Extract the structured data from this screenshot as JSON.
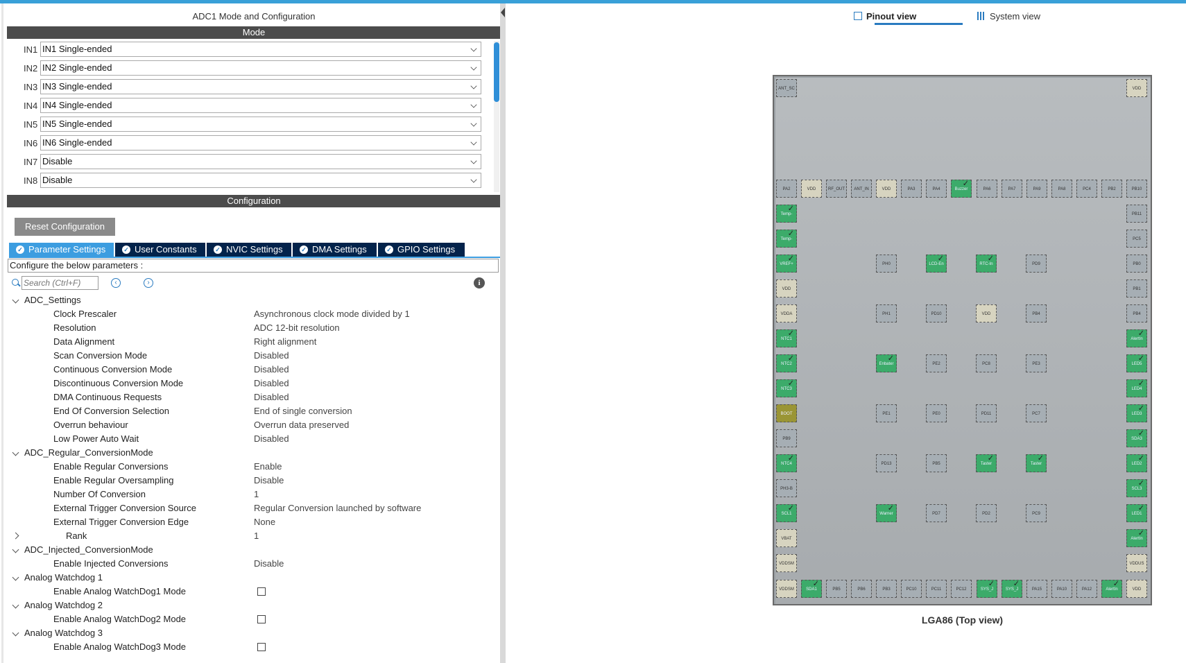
{
  "panel_title": "ADC1 Mode and Configuration",
  "mode_header": "Mode",
  "config_header": "Configuration",
  "mode_rows": [
    {
      "label": "IN1",
      "value": "IN1 Single-ended"
    },
    {
      "label": "IN2",
      "value": "IN2 Single-ended"
    },
    {
      "label": "IN3",
      "value": "IN3 Single-ended"
    },
    {
      "label": "IN4",
      "value": "IN4 Single-ended"
    },
    {
      "label": "IN5",
      "value": "IN5 Single-ended"
    },
    {
      "label": "IN6",
      "value": "IN6 Single-ended"
    },
    {
      "label": "IN7",
      "value": "Disable"
    },
    {
      "label": "IN8",
      "value": "Disable"
    }
  ],
  "reset_label": "Reset Configuration",
  "tabs": [
    {
      "label": "Parameter Settings",
      "active": true
    },
    {
      "label": "User Constants",
      "active": false
    },
    {
      "label": "NVIC Settings",
      "active": false
    },
    {
      "label": "DMA Settings",
      "active": false
    },
    {
      "label": "GPIO Settings",
      "active": false
    }
  ],
  "description": "Configure the below parameters :",
  "search": {
    "placeholder": "Search (Ctrl+F)"
  },
  "tree": [
    {
      "kind": "group",
      "name": "ADC_Settings",
      "expanded": true
    },
    {
      "kind": "param",
      "name": "Clock Prescaler",
      "value": "Asynchronous clock mode divided by 1"
    },
    {
      "kind": "param",
      "name": "Resolution",
      "value": "ADC 12-bit resolution"
    },
    {
      "kind": "param",
      "name": "Data Alignment",
      "value": "Right alignment"
    },
    {
      "kind": "param",
      "name": "Scan Conversion Mode",
      "value": "Disabled"
    },
    {
      "kind": "param",
      "name": "Continuous Conversion Mode",
      "value": "Disabled"
    },
    {
      "kind": "param",
      "name": "Discontinuous Conversion Mode",
      "value": "Disabled"
    },
    {
      "kind": "param",
      "name": "DMA Continuous Requests",
      "value": "Disabled"
    },
    {
      "kind": "param",
      "name": "End Of Conversion Selection",
      "value": "End of single conversion"
    },
    {
      "kind": "param",
      "name": "Overrun behaviour",
      "value": "Overrun data preserved"
    },
    {
      "kind": "param",
      "name": "Low Power Auto Wait",
      "value": "Disabled"
    },
    {
      "kind": "group",
      "name": "ADC_Regular_ConversionMode",
      "expanded": true
    },
    {
      "kind": "param",
      "name": "Enable Regular Conversions",
      "value": "Enable"
    },
    {
      "kind": "param",
      "name": "Enable Regular Oversampling",
      "value": "Disable"
    },
    {
      "kind": "param",
      "name": "Number Of Conversion",
      "value": "1"
    },
    {
      "kind": "param",
      "name": "External Trigger Conversion Source",
      "value": "Regular Conversion launched by software"
    },
    {
      "kind": "param",
      "name": "External Trigger Conversion Edge",
      "value": "None"
    },
    {
      "kind": "subgroup",
      "name": "Rank",
      "value": "1",
      "expanded": false
    },
    {
      "kind": "group",
      "name": "ADC_Injected_ConversionMode",
      "expanded": true
    },
    {
      "kind": "param",
      "name": "Enable Injected Conversions",
      "value": "Disable"
    },
    {
      "kind": "group",
      "name": "Analog Watchdog 1",
      "expanded": true
    },
    {
      "kind": "check",
      "name": "Enable Analog WatchDog1 Mode",
      "checked": false
    },
    {
      "kind": "group",
      "name": "Analog Watchdog 2",
      "expanded": true
    },
    {
      "kind": "check",
      "name": "Enable Analog WatchDog2 Mode",
      "checked": false
    },
    {
      "kind": "group",
      "name": "Analog Watchdog 3",
      "expanded": true
    },
    {
      "kind": "check",
      "name": "Enable Analog WatchDog3 Mode",
      "checked": false
    }
  ],
  "view_tabs": [
    {
      "label": "Pinout view",
      "active": true
    },
    {
      "label": "System view",
      "active": false
    }
  ],
  "chip_label": "LGA86 (Top view)",
  "pin_colors": {
    "unused": "#a6aeb4",
    "power": "#d7d4c0",
    "assigned": "#3cab6a",
    "reset": "#9a9535"
  },
  "pins": [
    {
      "t": "g",
      "l": "ANT_SC"
    },
    {
      "t": "p",
      "l": "VDD"
    },
    {
      "t": "g",
      "l": "PA2"
    },
    {
      "t": "p",
      "l": "VDD"
    },
    {
      "t": "g",
      "l": "RF_OUT"
    },
    {
      "t": "g",
      "l": "ANT_IN"
    },
    {
      "t": "p",
      "l": "VDD"
    },
    {
      "t": "g",
      "l": "PA3"
    },
    {
      "t": "g",
      "l": "PA4"
    },
    {
      "t": "gr",
      "l": "Buzzer"
    },
    {
      "t": "g",
      "l": "PA6"
    },
    {
      "t": "g",
      "l": "PA7"
    },
    {
      "t": "g",
      "l": "PA9"
    },
    {
      "t": "g",
      "l": "PA8"
    },
    {
      "t": "g",
      "l": "PC4"
    },
    {
      "t": "g",
      "l": "PB2"
    },
    {
      "t": "g",
      "l": "PB10"
    },
    {
      "t": "gr",
      "l": "Temp-"
    },
    {
      "t": "gr",
      "l": "Temp-"
    },
    {
      "t": "gr",
      "l": "VREF+"
    },
    {
      "t": "p",
      "l": "VDD"
    },
    {
      "t": "p",
      "l": "VDDA"
    },
    {
      "t": "gr",
      "l": "NTC1"
    },
    {
      "t": "gr",
      "l": "NTC2"
    },
    {
      "t": "gr",
      "l": "NTC3"
    },
    {
      "t": "ol",
      "l": "BOOT"
    },
    {
      "t": "g",
      "l": "PB9"
    },
    {
      "t": "gr",
      "l": "NTC4"
    },
    {
      "t": "g",
      "l": "PH3-B"
    },
    {
      "t": "gr",
      "l": "SCL1"
    },
    {
      "t": "p",
      "l": "VBAT"
    },
    {
      "t": "p",
      "l": "VDDSM"
    },
    {
      "t": "g",
      "l": "PB11"
    },
    {
      "t": "g",
      "l": "PC5"
    },
    {
      "t": "g",
      "l": "PB0"
    },
    {
      "t": "g",
      "l": "PB1"
    },
    {
      "t": "g",
      "l": "PB4"
    },
    {
      "t": "gr",
      "l": "AlertIn"
    },
    {
      "t": "gr",
      "l": "LED5"
    },
    {
      "t": "gr",
      "l": "LED4"
    },
    {
      "t": "gr",
      "l": "LED3"
    },
    {
      "t": "gr",
      "l": "SDA3"
    },
    {
      "t": "gr",
      "l": "LED2"
    },
    {
      "t": "gr",
      "l": "SCL3"
    },
    {
      "t": "gr",
      "l": "LED1"
    },
    {
      "t": "gr",
      "l": "AlertIn"
    },
    {
      "t": "p",
      "l": "VDDUS"
    },
    {
      "t": "p",
      "l": "VDDSM"
    },
    {
      "t": "gr",
      "l": "SDA1"
    },
    {
      "t": "g",
      "l": "PB5"
    },
    {
      "t": "g",
      "l": "PB6"
    },
    {
      "t": "g",
      "l": "PB3"
    },
    {
      "t": "g",
      "l": "PC10"
    },
    {
      "t": "g",
      "l": "PC11"
    },
    {
      "t": "g",
      "l": "PC12"
    },
    {
      "t": "gr",
      "l": "SYS_J"
    },
    {
      "t": "gr",
      "l": "SYS_J"
    },
    {
      "t": "g",
      "l": "PA15"
    },
    {
      "t": "g",
      "l": "PA10"
    },
    {
      "t": "g",
      "l": "PA12"
    },
    {
      "t": "gr",
      "l": "AlertIn"
    },
    {
      "t": "p",
      "l": "VDD"
    },
    {
      "t": "g",
      "l": "PH0"
    },
    {
      "t": "gr",
      "l": "LCD-En"
    },
    {
      "t": "gr",
      "l": "RTC-In"
    },
    {
      "t": "g",
      "l": "PD9"
    },
    {
      "t": "g",
      "l": "PH1"
    },
    {
      "t": "g",
      "l": "PD10"
    },
    {
      "t": "p",
      "l": "VDD"
    },
    {
      "t": "g",
      "l": "PB4"
    },
    {
      "t": "gr",
      "l": "Enbater"
    },
    {
      "t": "g",
      "l": "PE2"
    },
    {
      "t": "g",
      "l": "PC8"
    },
    {
      "t": "g",
      "l": "PE3"
    },
    {
      "t": "g",
      "l": "PE1"
    },
    {
      "t": "g",
      "l": "PE0"
    },
    {
      "t": "g",
      "l": "PD11"
    },
    {
      "t": "g",
      "l": "PC7"
    },
    {
      "t": "g",
      "l": "PD13"
    },
    {
      "t": "g",
      "l": "PB5"
    },
    {
      "t": "gr",
      "l": "Taster"
    },
    {
      "t": "gr",
      "l": "Taster"
    },
    {
      "t": "gr",
      "l": "Warner"
    },
    {
      "t": "g",
      "l": "PD7"
    },
    {
      "t": "g",
      "l": "PD2"
    },
    {
      "t": "g",
      "l": "PC9"
    }
  ]
}
